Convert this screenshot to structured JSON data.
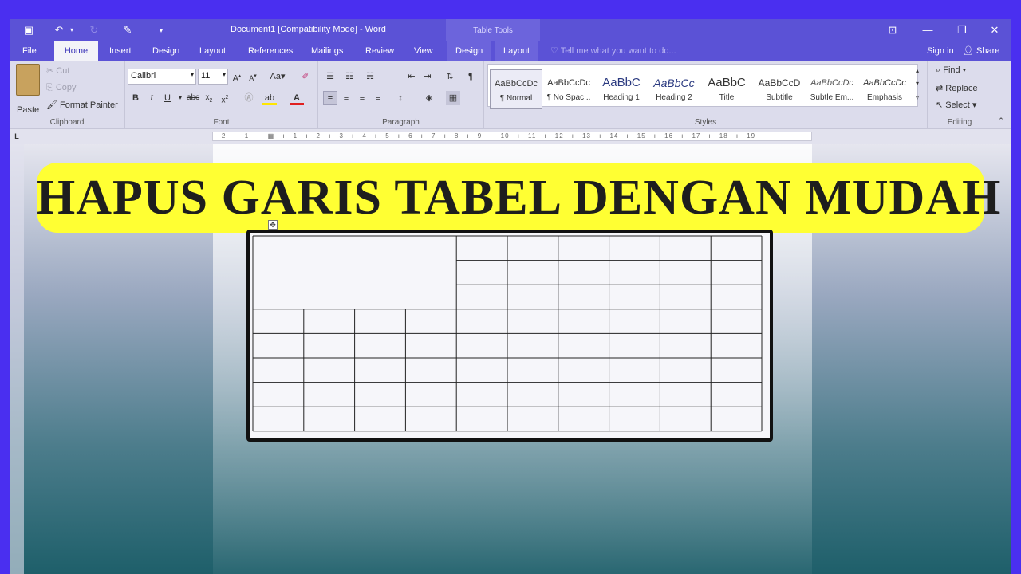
{
  "titlebar": {
    "title": "Document1 [Compatibility Mode] - Word",
    "context": "Table Tools"
  },
  "tabs": [
    "File",
    "Home",
    "Insert",
    "Design",
    "Layout",
    "References",
    "Mailings",
    "Review",
    "View",
    "Design",
    "Layout"
  ],
  "active_tab": "Home",
  "tell_me": "Tell me what you want to do...",
  "sign_in": "Sign in",
  "share": "Share",
  "clipboard": {
    "paste": "Paste",
    "cut": "Cut",
    "copy": "Copy",
    "format_painter": "Format Painter",
    "label": "Clipboard"
  },
  "font": {
    "name": "Calibri",
    "size": "11",
    "label": "Font"
  },
  "paragraph": {
    "label": "Paragraph"
  },
  "styles": {
    "label": "Styles",
    "items": [
      {
        "preview": "AaBbCcDc",
        "name": "¶ Normal"
      },
      {
        "preview": "AaBbCcDc",
        "name": "¶ No Spac..."
      },
      {
        "preview": "AaBbC",
        "name": "Heading 1"
      },
      {
        "preview": "AaBbCc",
        "name": "Heading 2"
      },
      {
        "preview": "AaBbC",
        "name": "Title"
      },
      {
        "preview": "AaBbCcD",
        "name": "Subtitle"
      },
      {
        "preview": "AaBbCcDc",
        "name": "Subtle Em..."
      },
      {
        "preview": "AaBbCcDc",
        "name": "Emphasis"
      }
    ]
  },
  "editing": {
    "find": "Find",
    "replace": "Replace",
    "select": "Select",
    "label": "Editing"
  },
  "ruler_text": "· 2 · ı · 1 · ı · ▦ · ı · 1 · ı · 2 · ı · 3 · ı · 4 · ı · 5 · ı · 6 · ı · 7 · ı · 8 · ı · 9 · ı · 10 · ı · 11 · ı · 12 · ı · 13 · ı · 14 · ı · 15 · ı · 16 · ı · 17 · ı · 18 · ı · 19",
  "banner": "HAPUS GARIS TABEL DENGAN MUDAH",
  "colors": {
    "accent": "#5b52d6",
    "banner_bg": "#ffff33",
    "frame": "#111111"
  }
}
